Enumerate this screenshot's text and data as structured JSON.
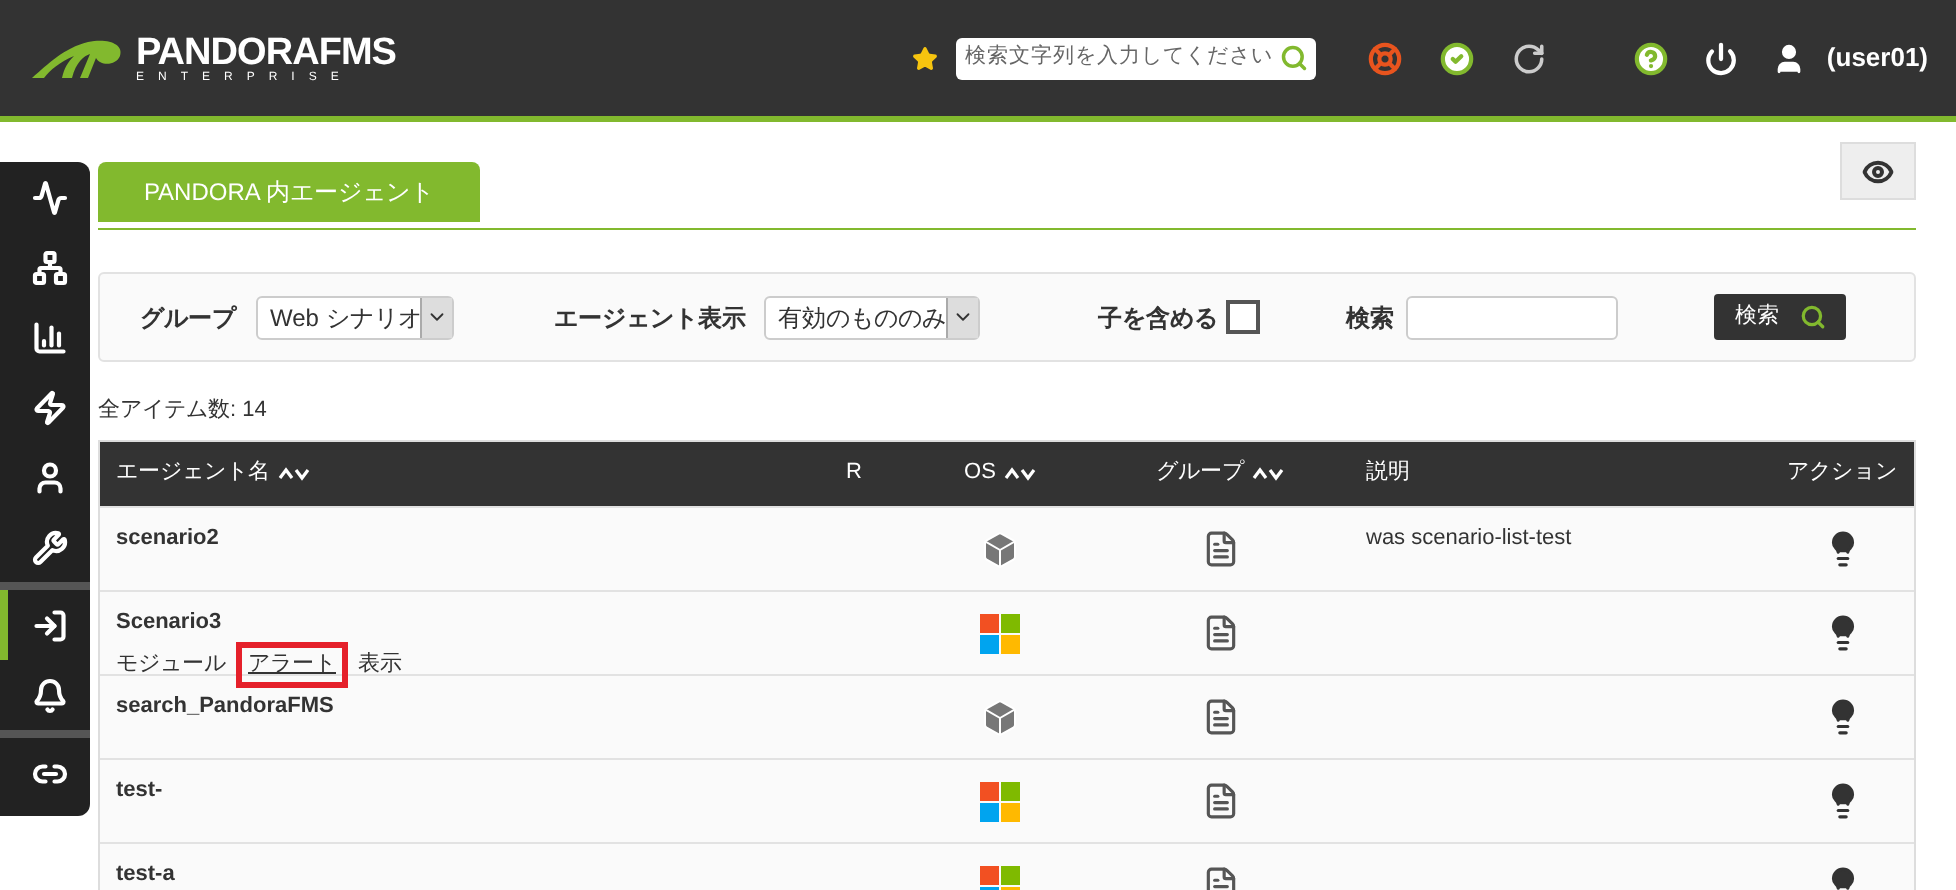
{
  "header": {
    "logo_title": "PANDORAFMS",
    "logo_subtitle": "ENTERPRISE",
    "search": {
      "placeholder": "検索文字列を入力してください"
    },
    "user": "(user01)"
  },
  "sidebar": {
    "groups": [
      [
        {
          "selected": false
        },
        {
          "selected": false
        },
        {
          "selected": false
        },
        {
          "selected": false
        },
        {
          "selected": false
        },
        {
          "selected": false
        }
      ],
      [
        {
          "selected": true
        },
        {
          "selected": false
        }
      ],
      [
        {
          "selected": false
        }
      ]
    ]
  },
  "tabs": [
    {
      "label": "PANDORA 内エージェント",
      "selected": true
    }
  ],
  "filters": {
    "group_label": "グループ",
    "group_value": "Web シナリオ",
    "display_label": "エージェント表示",
    "display_value": "有効のもののみ",
    "children_label": "子を含める",
    "children_checked": false,
    "search_label": "検索",
    "search_button": "検索"
  },
  "total": "全アイテム数: 14",
  "table": {
    "columns": [
      {
        "label": "エージェント名",
        "sortable": true
      },
      {
        "label": "R",
        "sortable": false
      },
      {
        "label": "OS",
        "sortable": true
      },
      {
        "label": "グループ",
        "sortable": true
      },
      {
        "label": "説明",
        "sortable": false
      },
      {
        "label": "アクション",
        "sortable": false
      }
    ],
    "rows": [
      {
        "name": "scenario2",
        "os": {
          "kind": "other"
        },
        "description": "was scenario-list-test"
      },
      {
        "name": "Scenario3",
        "os": {
          "kind": "windows"
        },
        "links": [
          {
            "label": "モジュール",
            "highlighted": false
          },
          {
            "label": "アラート",
            "highlighted": true
          },
          {
            "label": "表示",
            "highlighted": false
          }
        ]
      },
      {
        "name": "search_PandoraFMS",
        "os": {
          "kind": "other"
        }
      },
      {
        "name": "test-",
        "os": {
          "kind": "windows"
        }
      },
      {
        "name": "test-a",
        "os": {
          "kind": "windows"
        }
      }
    ]
  }
}
